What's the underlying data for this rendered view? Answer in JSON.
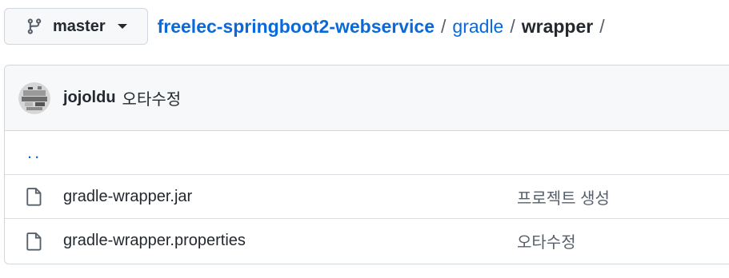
{
  "branch": {
    "label": "master",
    "icon": "git-branch-icon"
  },
  "breadcrumb": {
    "repo": "freelec-springboot2-webservice",
    "sep1": "/",
    "folder": "gradle",
    "sep2": "/",
    "current": "wrapper",
    "sep3": "/"
  },
  "commit": {
    "author": "jojoldu",
    "message": "오타수정"
  },
  "files": {
    "parent": "..",
    "items": [
      {
        "name": "gradle-wrapper.jar",
        "commit": "프로젝트 생성",
        "icon": "file-icon"
      },
      {
        "name": "gradle-wrapper.properties",
        "commit": "오타수정",
        "icon": "file-icon"
      }
    ]
  },
  "colors": {
    "link": "#0969da",
    "border": "#d0d7de",
    "header_bg": "#f6f8fa"
  }
}
